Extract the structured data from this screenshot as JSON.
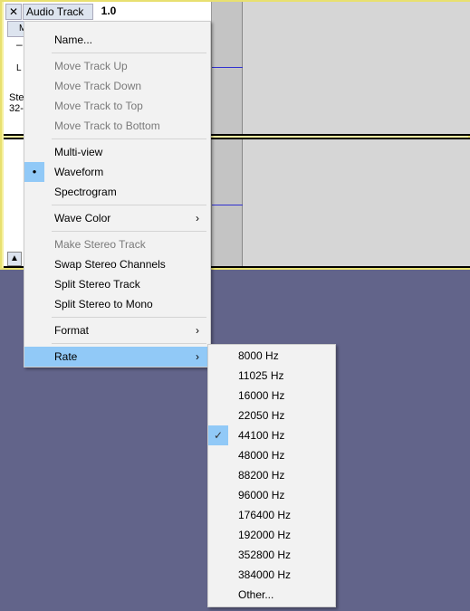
{
  "track": {
    "close": "✕",
    "name": "Audio Track",
    "gain": "1.0",
    "mute": "M",
    "slider_min": "–",
    "pan": "L",
    "info1": "Ste",
    "info2": "32-"
  },
  "menu": {
    "items": [
      {
        "label": "Name...",
        "enabled": true
      },
      {
        "label": "Move Track Up",
        "enabled": false
      },
      {
        "label": "Move Track Down",
        "enabled": false
      },
      {
        "label": "Move Track to Top",
        "enabled": false
      },
      {
        "label": "Move Track to Bottom",
        "enabled": false
      },
      {
        "label": "Multi-view",
        "enabled": true
      },
      {
        "label": "Waveform",
        "enabled": true,
        "checked": true
      },
      {
        "label": "Spectrogram",
        "enabled": true
      },
      {
        "label": "Wave Color",
        "enabled": true,
        "submenu": true
      },
      {
        "label": "Make Stereo Track",
        "enabled": false
      },
      {
        "label": "Swap Stereo Channels",
        "enabled": true
      },
      {
        "label": "Split Stereo Track",
        "enabled": true
      },
      {
        "label": "Split Stereo to Mono",
        "enabled": true
      },
      {
        "label": "Format",
        "enabled": true,
        "submenu": true
      },
      {
        "label": "Rate",
        "enabled": true,
        "submenu": true,
        "highlighted": true
      }
    ],
    "arrow": "›",
    "bullet": "●"
  },
  "rate_menu": {
    "items": [
      "8000 Hz",
      "11025 Hz",
      "16000 Hz",
      "22050 Hz",
      "44100 Hz",
      "48000 Hz",
      "88200 Hz",
      "96000 Hz",
      "176400 Hz",
      "192000 Hz",
      "352800 Hz",
      "384000 Hz",
      "Other..."
    ],
    "selected": "44100 Hz",
    "check": "✓"
  },
  "colors": {
    "background": "#62648a",
    "highlight": "#91c9f7",
    "waveform_line": "#3030d0"
  }
}
